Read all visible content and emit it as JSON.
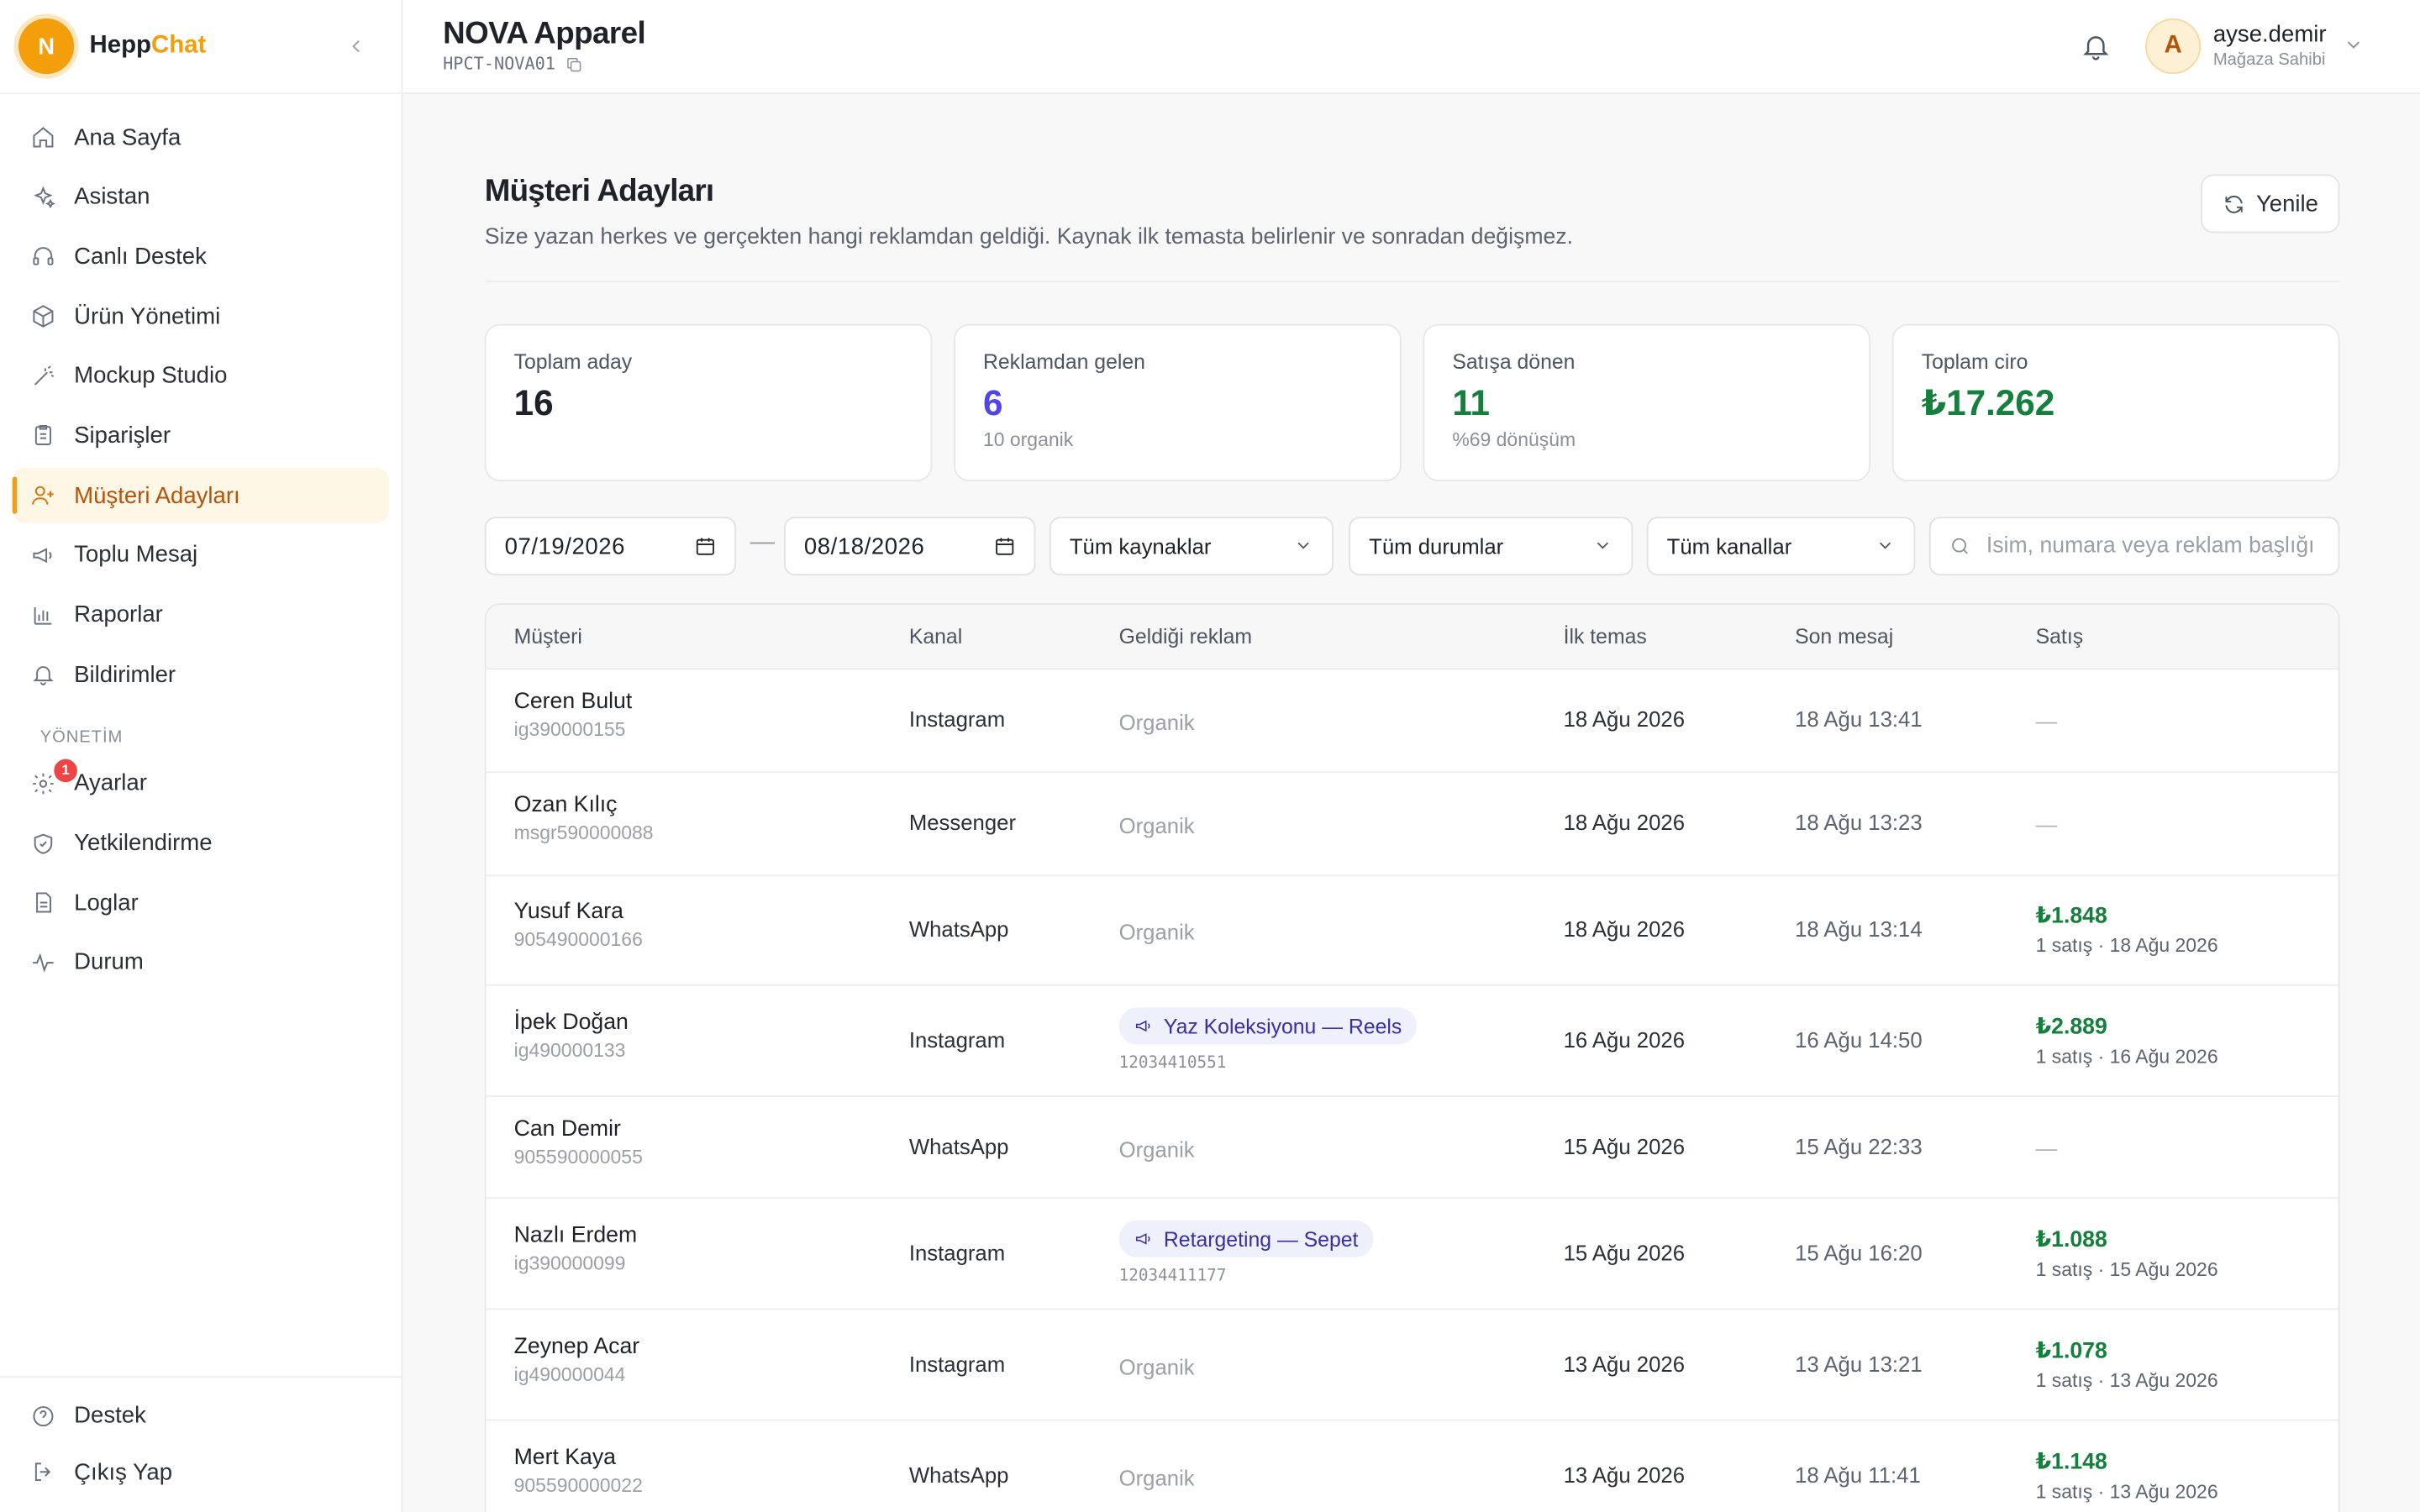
{
  "brand": {
    "logo_letter": "N",
    "name_primary": "Hepp",
    "name_accent": "Chat",
    "accent_color": "#f59e0b"
  },
  "sidebar": {
    "items": [
      {
        "label": "Ana Sayfa",
        "icon": "home-icon"
      },
      {
        "label": "Asistan",
        "icon": "sparkles-icon"
      },
      {
        "label": "Canlı Destek",
        "icon": "headset-icon"
      },
      {
        "label": "Ürün Yönetimi",
        "icon": "box-icon"
      },
      {
        "label": "Mockup Studio",
        "icon": "magic-wand-icon"
      },
      {
        "label": "Siparişler",
        "icon": "clipboard-icon"
      },
      {
        "label": "Müşteri Adayları",
        "icon": "user-plus-icon",
        "active": true
      },
      {
        "label": "Toplu Mesaj",
        "icon": "megaphone-icon"
      },
      {
        "label": "Raporlar",
        "icon": "bar-chart-icon"
      },
      {
        "label": "Bildirimler",
        "icon": "bell-icon"
      }
    ],
    "section_title": "YÖNETİM",
    "admin_items": [
      {
        "label": "Ayarlar",
        "icon": "gear-icon",
        "badge": "1"
      },
      {
        "label": "Yetkilendirme",
        "icon": "shield-check-icon"
      },
      {
        "label": "Loglar",
        "icon": "file-text-icon"
      },
      {
        "label": "Durum",
        "icon": "activity-icon"
      }
    ],
    "footer_items": [
      {
        "label": "Destek",
        "icon": "help-circle-icon"
      },
      {
        "label": "Çıkış Yap",
        "icon": "logout-icon"
      }
    ]
  },
  "header": {
    "store_name": "NOVA Apparel",
    "store_code": "HPCT-NOVA01",
    "user": {
      "avatar_letter": "A",
      "name": "ayse.demir",
      "role": "Mağaza Sahibi"
    }
  },
  "page": {
    "title": "Müşteri Adayları",
    "subtitle": "Size yazan herkes ve gerçekten hangi reklamdan geldiği. Kaynak ilk temasta belirlenir ve sonradan değişmez.",
    "refresh_label": "Yenile"
  },
  "stats": [
    {
      "label": "Toplam aday",
      "value": "16",
      "sub": ""
    },
    {
      "label": "Reklamdan gelen",
      "value": "6",
      "sub": "10 organik",
      "color": "#4f46e5"
    },
    {
      "label": "Satışa dönen",
      "value": "11",
      "sub": "%69 dönüşüm",
      "color": "#15803d"
    },
    {
      "label": "Toplam ciro",
      "value": "₺17.262",
      "sub": "",
      "color": "#15803d"
    }
  ],
  "filters": {
    "date_from": "07/19/2026",
    "date_to": "08/18/2026",
    "date_separator": "—",
    "source": "Tüm kaynaklar",
    "status": "Tüm durumlar",
    "channel": "Tüm kanallar",
    "search_placeholder": "İsim, numara veya reklam başlığı ara"
  },
  "table": {
    "columns": [
      "Müşteri",
      "Kanal",
      "Geldiği reklam",
      "İlk temas",
      "Son mesaj",
      "Satış"
    ],
    "rows": [
      {
        "name": "Ceren Bulut",
        "handle": "ig390000155",
        "kanal": "Instagram",
        "ad": "Organik",
        "ad_id": "",
        "ilk": "18 Ağu 2026",
        "son": "18 Ağu 13:41",
        "amount": "",
        "satis_sub": "",
        "none": "—"
      },
      {
        "name": "Ozan Kılıç",
        "handle": "msgr590000088",
        "kanal": "Messenger",
        "ad": "Organik",
        "ad_id": "",
        "ilk": "18 Ağu 2026",
        "son": "18 Ağu 13:23",
        "amount": "",
        "satis_sub": "",
        "none": "—"
      },
      {
        "name": "Yusuf Kara",
        "handle": "905490000166",
        "kanal": "WhatsApp",
        "ad": "Organik",
        "ad_id": "",
        "ilk": "18 Ağu 2026",
        "son": "18 Ağu 13:14",
        "amount": "₺1.848",
        "satis_sub": "1 satış · 18 Ağu 2026",
        "none": ""
      },
      {
        "name": "İpek Doğan",
        "handle": "ig490000133",
        "kanal": "Instagram",
        "ad": "Yaz Koleksiyonu — Reels",
        "ad_id": "12034410551",
        "ilk": "16 Ağu 2026",
        "son": "16 Ağu 14:50",
        "amount": "₺2.889",
        "satis_sub": "1 satış · 16 Ağu 2026",
        "none": ""
      },
      {
        "name": "Can Demir",
        "handle": "905590000055",
        "kanal": "WhatsApp",
        "ad": "Organik",
        "ad_id": "",
        "ilk": "15 Ağu 2026",
        "son": "15 Ağu 22:33",
        "amount": "",
        "satis_sub": "",
        "none": "—"
      },
      {
        "name": "Nazlı Erdem",
        "handle": "ig390000099",
        "kanal": "Instagram",
        "ad": "Retargeting — Sepet",
        "ad_id": "12034411177",
        "ilk": "15 Ağu 2026",
        "son": "15 Ağu 16:20",
        "amount": "₺1.088",
        "satis_sub": "1 satış · 15 Ağu 2026",
        "none": ""
      },
      {
        "name": "Zeynep Acar",
        "handle": "ig490000044",
        "kanal": "Instagram",
        "ad": "Organik",
        "ad_id": "",
        "ilk": "13 Ağu 2026",
        "son": "13 Ağu 13:21",
        "amount": "₺1.078",
        "satis_sub": "1 satış · 13 Ağu 2026",
        "none": ""
      },
      {
        "name": "Mert Kaya",
        "handle": "905590000022",
        "kanal": "WhatsApp",
        "ad": "Organik",
        "ad_id": "",
        "ilk": "13 Ağu 2026",
        "son": "18 Ağu 11:41",
        "amount": "₺1.148",
        "satis_sub": "1 satış · 13 Ağu 2026",
        "none": ""
      }
    ]
  }
}
